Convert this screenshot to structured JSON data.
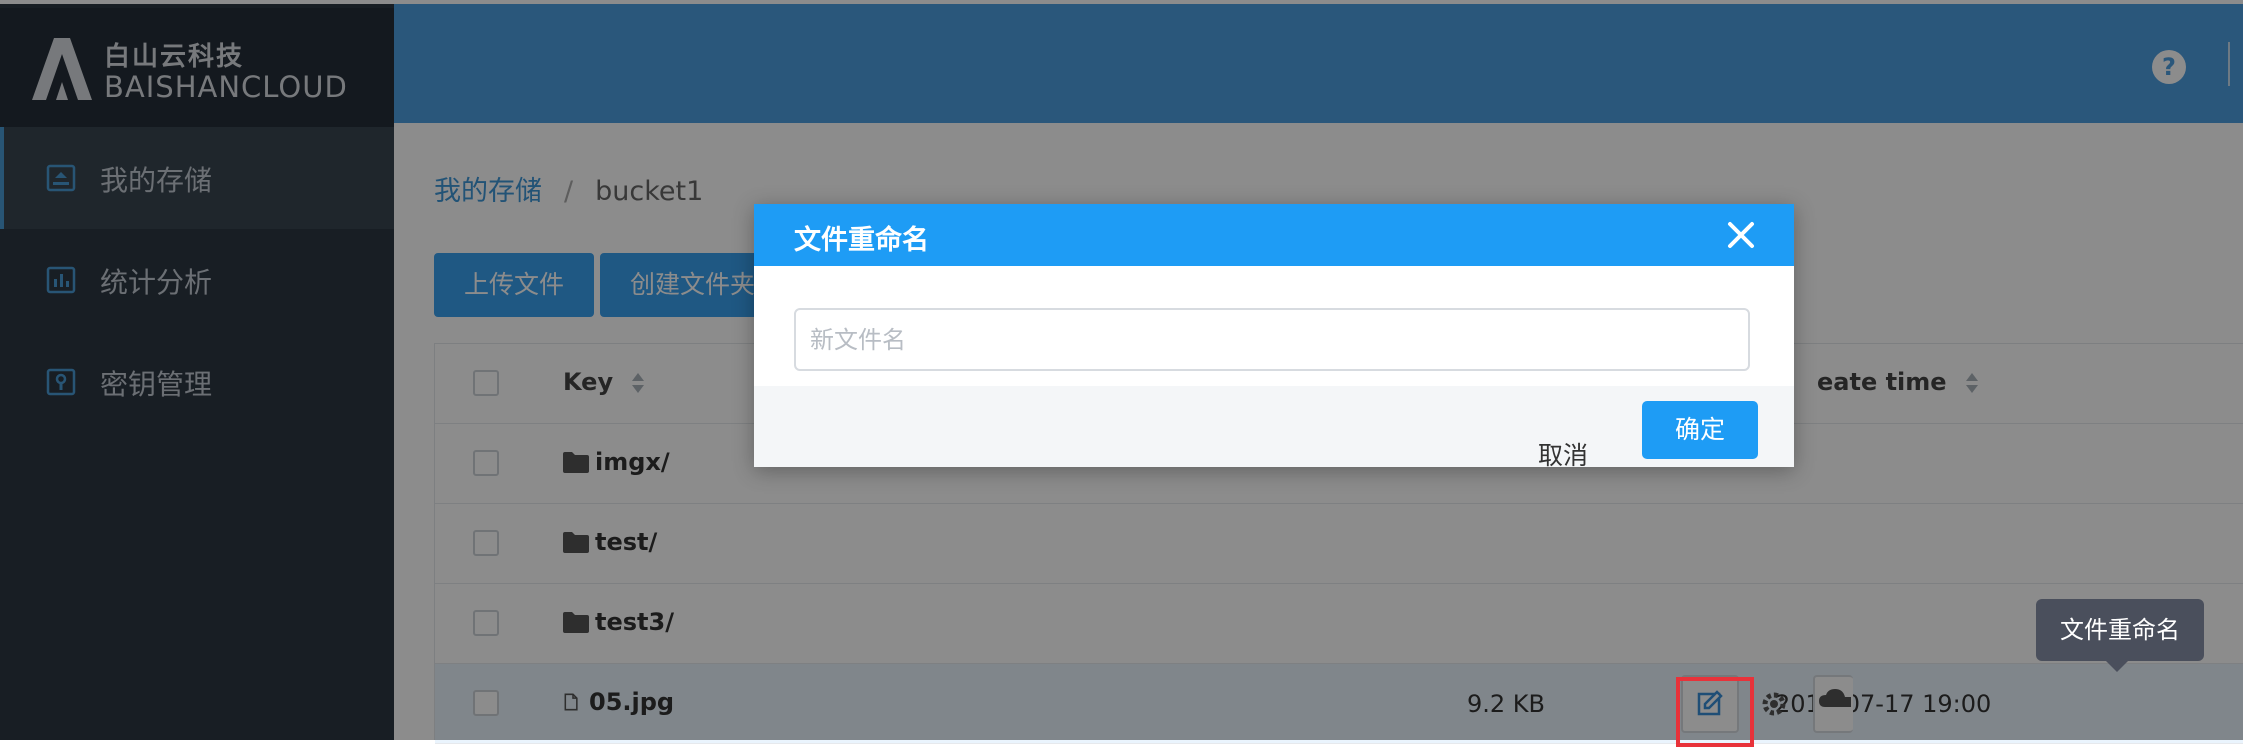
{
  "brand": {
    "name_cn": "白山云科技",
    "name_en": "BAISHANCLOUD"
  },
  "sidebar": {
    "items": [
      {
        "label": "我的存储",
        "icon": "storage-icon",
        "active": true
      },
      {
        "label": "统计分析",
        "icon": "bar-chart-icon",
        "active": false
      },
      {
        "label": "密钥管理",
        "icon": "key-icon",
        "active": false
      }
    ]
  },
  "topbar": {
    "help_label": "?"
  },
  "breadcrumb": {
    "root": "我的存储",
    "separator": "/",
    "current": "bucket1"
  },
  "toolbar": {
    "upload_label": "上传文件",
    "create_folder_label": "创建文件夹"
  },
  "table": {
    "columns": {
      "key": "Key",
      "create_time": "eate time"
    },
    "rows": [
      {
        "key": "imgx/",
        "type": "folder",
        "size": "",
        "time": ""
      },
      {
        "key": "test/",
        "type": "folder",
        "size": "",
        "time": ""
      },
      {
        "key": "test3/",
        "type": "folder",
        "size": "",
        "time": ""
      },
      {
        "key": "05.jpg",
        "type": "file",
        "size": "9.2 KB",
        "time": "2017-07-17 19:00"
      }
    ]
  },
  "tooltip": {
    "text": "文件重命名"
  },
  "modal": {
    "title": "文件重命名",
    "input_placeholder": "新文件名",
    "input_value": "",
    "cancel_label": "取消",
    "confirm_label": "确定"
  },
  "colors": {
    "sidebar_bg": "#2d3743",
    "header_blue": "#4d9ee0",
    "primary": "#1e9cf5",
    "highlight_red": "#e8323a"
  }
}
